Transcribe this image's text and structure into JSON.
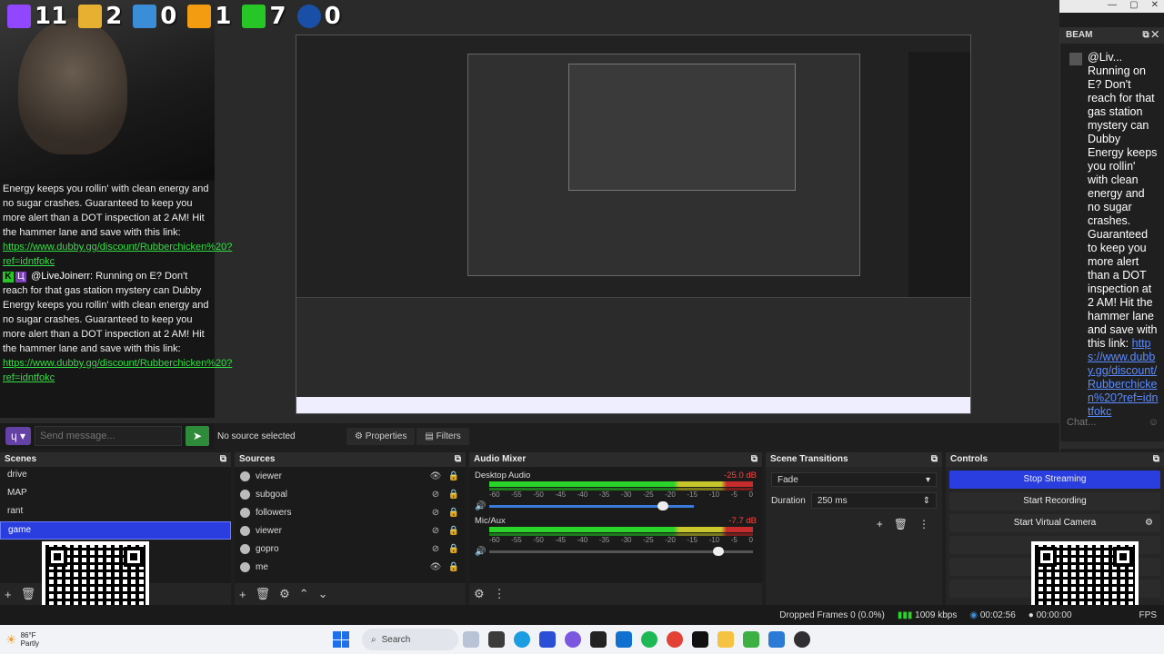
{
  "stream_stats": {
    "twitch": "11",
    "v_count": "2",
    "t_count": "0",
    "b_count": "1",
    "k_count": "7",
    "v2_count": "0"
  },
  "left_chat": {
    "msg1_text": "Energy keeps you rollin' with clean energy and no sugar crashes. Guaranteed to keep you more alert than a DOT inspection at 2 AM! Hit the hammer lane and save with this link:",
    "msg1_link": "https://www.dubby.gg/discount/Rubberchicken%20?ref=idntfokc",
    "msg2_user": "@LiveJoinerr:",
    "msg2_text": "Running on E? Don't reach for that gas station mystery can Dubby Energy keeps you rollin' with clean energy and no sugar crashes. Guaranteed to keep you more alert than a DOT inspection at 2 AM! Hit the hammer lane and save with this link:",
    "msg2_link": "https://www.dubby.gg/discount/Rubberchicken%20?ref=idntfokc",
    "send_placeholder": "Send message..."
  },
  "beam": {
    "title": "BEAM",
    "user": "@Liv...",
    "text": "Running on E? Don't reach for that gas station mystery can Dubby Energy keeps you rollin' with clean energy and no sugar crashes. Guaranteed to keep you more alert than a DOT inspection at 2 AM! Hit the hammer lane and save with this link:",
    "link": "https://www.dubby.gg/discount/Rubberchicken%20?ref=idntfokc",
    "chat_placeholder": "Chat..."
  },
  "source_bar": {
    "no_source": "No source selected",
    "properties": "Properties",
    "filters": "Filters"
  },
  "scenes": {
    "title": "Scenes",
    "items": [
      "drive",
      "MAP",
      "rant",
      "game"
    ],
    "selected": "game"
  },
  "sources": {
    "title": "Sources",
    "items": [
      "viewer",
      "subgoal",
      "followers",
      "viewer",
      "gopro",
      "me"
    ]
  },
  "mixer": {
    "title": "Audio Mixer",
    "channels": [
      {
        "name": "Desktop Audio",
        "db": "-25.0 dB",
        "volume": 0.66
      },
      {
        "name": "Mic/Aux",
        "db": "-7.7 dB",
        "volume": 0.87
      }
    ],
    "ticks": [
      "-60",
      "-55",
      "-50",
      "-45",
      "-40",
      "-35",
      "-30",
      "-25",
      "-20",
      "-15",
      "-10",
      "-5",
      "0"
    ]
  },
  "transitions": {
    "title": "Scene Transitions",
    "selected": "Fade",
    "duration_label": "Duration",
    "duration_value": "250 ms"
  },
  "controls": {
    "title": "Controls",
    "stop_streaming": "Stop Streaming",
    "start_recording": "Start Recording",
    "start_virtual_camera": "Start Virtual Camera"
  },
  "status": {
    "dropped": "Dropped Frames 0 (0.0%)",
    "bitrate": "1009 kbps",
    "stream_time": "00:02:56",
    "rec_time": "00:00:00",
    "fps": "FPS"
  },
  "taskbar": {
    "weather_temp": "86°F",
    "weather_desc": "Partly",
    "search": "Search"
  },
  "colors": {
    "accent": "#2a3ee0",
    "link_green": "#33dd44",
    "link_blue": "#5b8cff"
  }
}
